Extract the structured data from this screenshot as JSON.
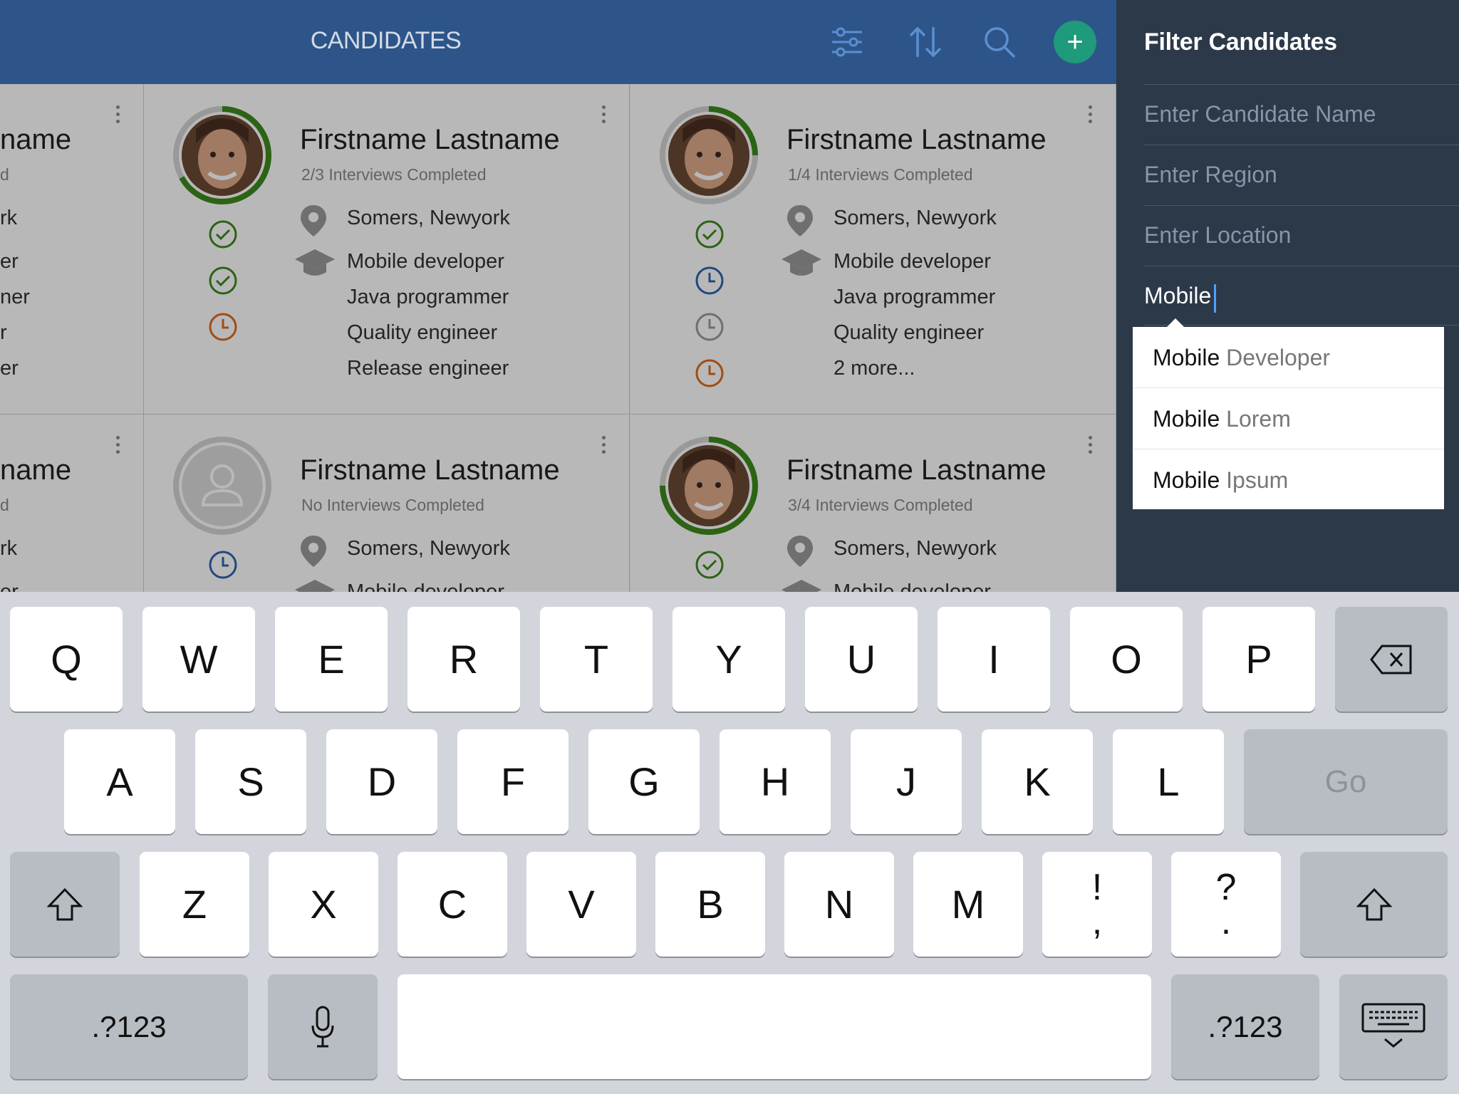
{
  "header": {
    "title": "CANDIDATES",
    "icons": [
      "filter-sliders-icon",
      "sort-icon",
      "search-icon",
      "add-icon"
    ],
    "add_label": "+",
    "background_color": "#2d5589"
  },
  "cards": [
    {
      "name": "name",
      "interviews": "d",
      "location": "rk",
      "roles": [
        "er",
        "ner",
        "r",
        "er"
      ]
    },
    {
      "name": "Firstname Lastname",
      "interviews": "2/3 Interviews Completed",
      "location": "Somers, Newyork",
      "roles": [
        "Mobile developer",
        "Java programmer",
        "Quality engineer",
        "Release engineer"
      ],
      "progress": 0.67,
      "statuses": [
        "check-green",
        "check-green",
        "clock-orange"
      ]
    },
    {
      "name": "Firstname Lastname",
      "interviews": "1/4 Interviews Completed",
      "location": "Somers, Newyork",
      "roles": [
        "Mobile developer",
        "Java programmer",
        "Quality engineer",
        "2 more..."
      ],
      "progress": 0.25,
      "statuses": [
        "check-green",
        "clock-blue",
        "clock-gray",
        "clock-orange"
      ]
    },
    {
      "name": "name",
      "interviews": "d",
      "location": "rk",
      "roles": [
        "er"
      ]
    },
    {
      "name": "Firstname Lastname",
      "interviews": "No Interviews Completed",
      "location": "Somers, Newyork",
      "roles": [
        "Mobile developer"
      ],
      "progress": 0,
      "statuses": [
        "clock-blue"
      ]
    },
    {
      "name": "Firstname Lastname",
      "interviews": "3/4 Interviews Completed",
      "location": "Somers, Newyork",
      "roles": [
        "Mobile developer"
      ],
      "progress": 0.75,
      "statuses": [
        "check-green"
      ]
    }
  ],
  "filter": {
    "title": "Filter Candidates",
    "name_placeholder": "Enter Candidate Name",
    "region_placeholder": "Enter Region",
    "location_placeholder": "Enter Location",
    "role_value": "Mobile",
    "suggestions": [
      {
        "match": "Mobile",
        "rest": " Developer"
      },
      {
        "match": "Mobile",
        "rest": " Lorem"
      },
      {
        "match": "Mobile",
        "rest": " Ipsum"
      }
    ]
  },
  "keyboard": {
    "row1": [
      "Q",
      "W",
      "E",
      "R",
      "T",
      "Y",
      "U",
      "I",
      "O",
      "P"
    ],
    "row2": [
      "A",
      "S",
      "D",
      "F",
      "G",
      "H",
      "J",
      "K",
      "L"
    ],
    "row3": [
      "Z",
      "X",
      "C",
      "V",
      "B",
      "N",
      "M"
    ],
    "punct1_top": "!",
    "punct1_bottom": ",",
    "punct2_top": "?",
    "punct2_bottom": ".",
    "go_label": "Go",
    "numbers_label": ".?123",
    "icons": [
      "backspace-icon",
      "shift-icon",
      "microphone-icon",
      "keyboard-dismiss-icon"
    ]
  }
}
